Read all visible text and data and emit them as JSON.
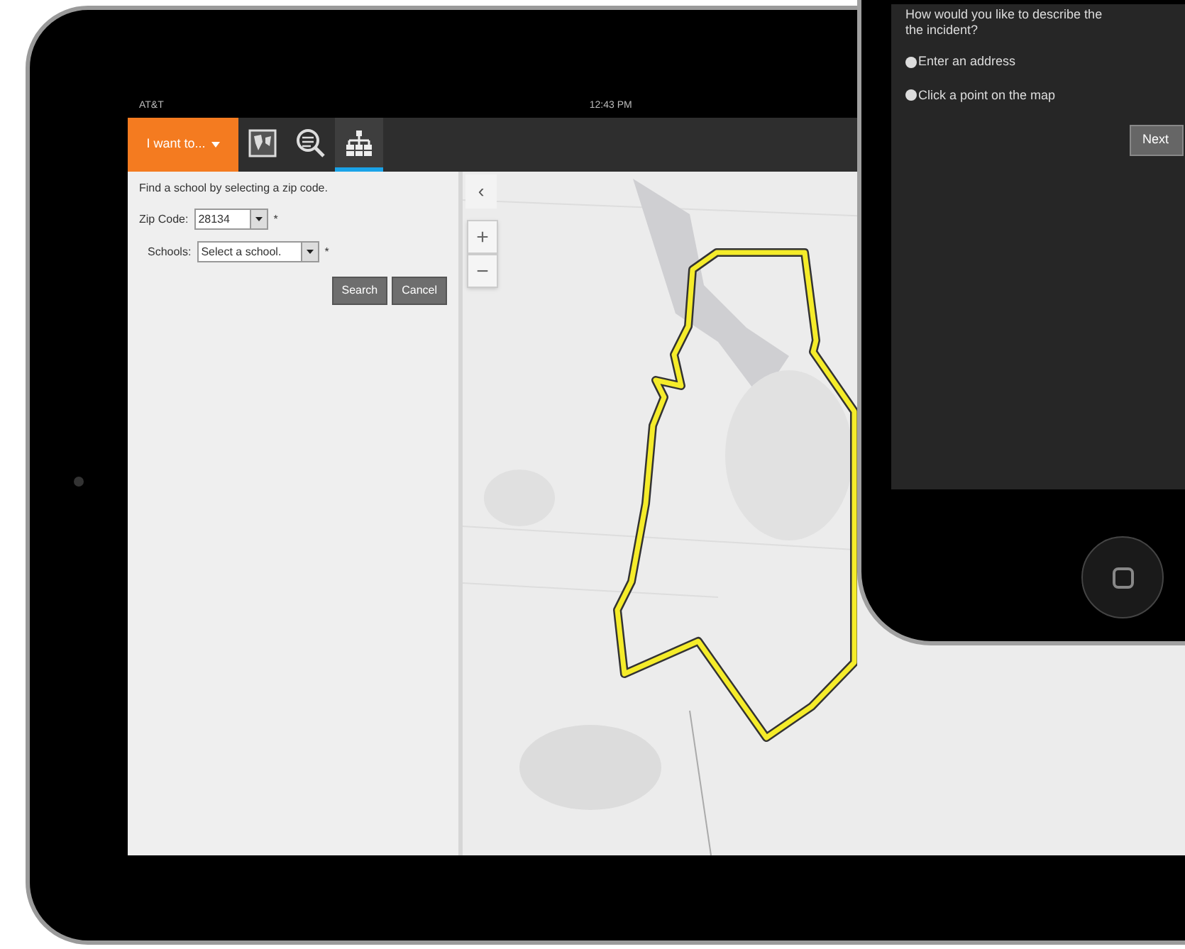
{
  "tablet": {
    "status_bar": {
      "carrier": "AT&T",
      "time": "12:43 PM"
    },
    "toolbar": {
      "menu_button": "I want to...",
      "tools": [
        {
          "kind": "map",
          "selected": false
        },
        {
          "kind": "search",
          "selected": false
        },
        {
          "kind": "tree",
          "selected": true
        }
      ]
    },
    "panel": {
      "instruction": "Find a school by selecting a zip code.",
      "fields": [
        {
          "label": "Zip Code:",
          "value": "28134",
          "required_mark": "*"
        },
        {
          "label": "Schools:",
          "value": "Select a school.",
          "required_mark": "*"
        }
      ],
      "buttons": [
        "Search",
        "Cancel"
      ]
    },
    "map": {
      "collapse": "‹",
      "zoom_in": "+",
      "zoom_out": "−"
    }
  },
  "phone": {
    "question": "How would you like to describe the",
    "question_line_2": "the incident?",
    "options": [
      {
        "label": "Enter an address",
        "selected": false
      },
      {
        "label": "Click a point on the map",
        "selected": false
      }
    ],
    "button": "Next"
  }
}
